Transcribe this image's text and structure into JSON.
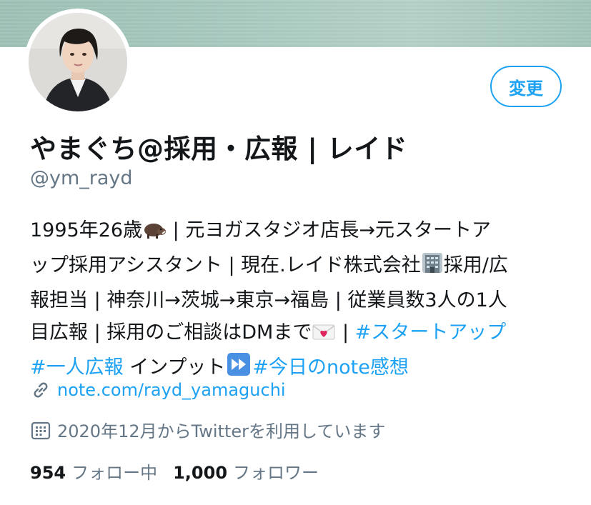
{
  "profile": {
    "display_name": "やまぐち@採用・広報 | レイド",
    "handle": "@ym_rayd",
    "edit_button_label": "変更"
  },
  "bio": {
    "line1_a": "1995年26歳",
    "line1_b": " | 元ヨガスタジオ店長→元スタートア",
    "line2_a": "ップ採用アシスタント | 現在.レイド株式会社",
    "line2_b": "採用/広",
    "line3": "報担当 | 神奈川→茨城→東京→福島 | 従業員数3人の1人",
    "line4_a": "目広報 | 採用のご相談はDMまで",
    "line4_b": " | ",
    "hashtag_startup": "#スタートアップ",
    "hashtag_solo_pr": "#一人広報",
    "line5_b": " インプット",
    "hashtag_note": "#今日のnote感想"
  },
  "icons": {
    "boar": "boar-emoji",
    "office": "office-building-emoji",
    "love_letter": "love-letter-emoji",
    "fast_forward": "fast-forward-emoji",
    "link": "link-icon",
    "calendar": "calendar-icon"
  },
  "website": {
    "url_text": "note.com/rayd_yamaguchi"
  },
  "joined": {
    "text": "2020年12月からTwitterを利用しています"
  },
  "stats": {
    "following_count": "954",
    "following_label": "フォロー中",
    "followers_count": "1,000",
    "followers_label": "フォロワー"
  },
  "colors": {
    "accent": "#1da1f2",
    "text_primary": "#14171a",
    "text_secondary": "#657786",
    "banner": "#a9cac0"
  }
}
